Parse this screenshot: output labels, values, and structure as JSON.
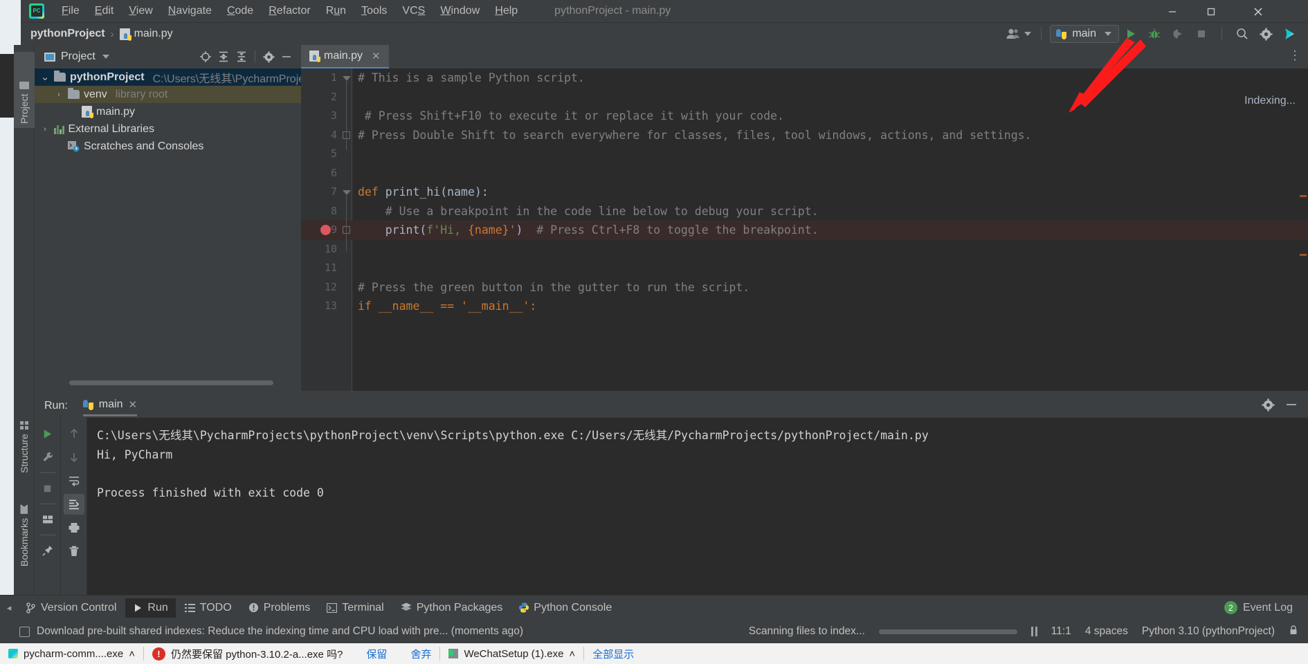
{
  "window": {
    "title": "pythonProject - main.py",
    "app_icon": "pycharm-logo-icon",
    "minimize": "─",
    "maximize": "☐",
    "close": "✕"
  },
  "menu": {
    "items": [
      {
        "label": "File",
        "mnemonic": "F"
      },
      {
        "label": "Edit",
        "mnemonic": "E"
      },
      {
        "label": "View",
        "mnemonic": "V"
      },
      {
        "label": "Navigate",
        "mnemonic": "N"
      },
      {
        "label": "Code",
        "mnemonic": "C"
      },
      {
        "label": "Refactor",
        "mnemonic": "R"
      },
      {
        "label": "Run",
        "mnemonic": "u"
      },
      {
        "label": "Tools",
        "mnemonic": "T"
      },
      {
        "label": "VCS",
        "mnemonic": "S"
      },
      {
        "label": "Window",
        "mnemonic": "W"
      },
      {
        "label": "Help",
        "mnemonic": "H"
      }
    ]
  },
  "navbar": {
    "breadcrumb_project": "pythonProject",
    "breadcrumb_sep": "›",
    "breadcrumb_file": "main.py",
    "run_config": "main",
    "icons": {
      "people": "people-icon",
      "run": "run-icon",
      "debug": "debug-icon",
      "coverage": "coverage-icon",
      "stop": "stop-icon",
      "search": "search-icon",
      "settings": "gear-icon",
      "assistant": "ai-assistant-icon"
    }
  },
  "left_strip": {
    "project": "Project",
    "structure": "Structure",
    "bookmarks": "Bookmarks"
  },
  "project_panel": {
    "title": "Project",
    "toolbar_icons": [
      "locate-icon",
      "expand-all-icon",
      "collapse-all-icon",
      "gear-icon",
      "hide-icon"
    ],
    "tree": [
      {
        "label": "pythonProject",
        "hint": "C:\\Users\\无线其\\PycharmProjec",
        "level": 0,
        "expanded": true,
        "selected": "blue",
        "icon": "folder-icon",
        "bold": true
      },
      {
        "label": "venv",
        "hint": "library root",
        "level": 1,
        "expanded": false,
        "selected": "olive",
        "icon": "folder-icon",
        "bold": false
      },
      {
        "label": "main.py",
        "hint": "",
        "level": 2,
        "expanded": null,
        "selected": "none",
        "icon": "python-file-icon",
        "bold": false
      },
      {
        "label": "External Libraries",
        "hint": "",
        "level": 0,
        "expanded": false,
        "selected": "none",
        "icon": "libraries-icon",
        "bold": false
      },
      {
        "label": "Scratches and Consoles",
        "hint": "",
        "level": 1,
        "expanded": null,
        "selected": "none",
        "icon": "scratches-icon",
        "bold": false
      }
    ]
  },
  "editor": {
    "tab": {
      "label": "main.py",
      "icon": "python-file-icon",
      "close": "✕"
    },
    "status_right": "Indexing...",
    "lines": [
      {
        "n": "1",
        "fold": "tri",
        "tokens": [
          {
            "t": "# This is a sample Python script.",
            "c": "cmt"
          }
        ]
      },
      {
        "n": "2",
        "fold": "",
        "tokens": []
      },
      {
        "n": "3",
        "fold": "",
        "tokens": [
          {
            "t": " # Press Shift+F10 to execute it or replace it with your code.",
            "c": "cmt"
          }
        ]
      },
      {
        "n": "4",
        "fold": "box",
        "tokens": [
          {
            "t": "# Press Double Shift to search everywhere for classes, files, tool windows, actions, and settings.",
            "c": "cmt"
          }
        ]
      },
      {
        "n": "5",
        "fold": "",
        "tokens": []
      },
      {
        "n": "6",
        "fold": "",
        "tokens": []
      },
      {
        "n": "7",
        "fold": "tri",
        "tokens": [
          {
            "t": "def ",
            "c": "kw"
          },
          {
            "t": "print_hi(name):",
            "c": "fn"
          }
        ]
      },
      {
        "n": "8",
        "fold": "",
        "tokens": [
          {
            "t": "    # Use a breakpoint in the code line below to debug your script.",
            "c": "cmt"
          }
        ]
      },
      {
        "n": "9",
        "fold": "box",
        "breakpoint": true,
        "highlight": true,
        "tokens": [
          {
            "t": "    print(",
            "c": "fn"
          },
          {
            "t": "f'Hi, ",
            "c": "str"
          },
          {
            "t": "{name}",
            "c": "brace"
          },
          {
            "t": "'",
            "c": "str"
          },
          {
            "t": ")",
            "c": "fn"
          },
          {
            "t": "  # Press Ctrl+F8 to toggle the breakpoint.",
            "c": "cmt"
          }
        ]
      },
      {
        "n": "10",
        "fold": "",
        "tokens": []
      },
      {
        "n": "11",
        "fold": "",
        "tokens": []
      },
      {
        "n": "12",
        "fold": "",
        "tokens": [
          {
            "t": "# Press the green button in the gutter to run the script.",
            "c": "cmt"
          }
        ]
      },
      {
        "n": "13",
        "fold": "",
        "tokens": [
          {
            "t": "if __name__ == '__main__':",
            "c": "kw"
          }
        ]
      }
    ]
  },
  "run_panel": {
    "label": "Run:",
    "tab": "main",
    "tab_icon": "python-icon",
    "tab_close": "✕",
    "header_icons": [
      "gear-icon",
      "hide-icon"
    ],
    "toolbar_left": [
      "rerun-icon",
      "wrench-icon",
      "stop-icon",
      "layout-icon",
      "pin-icon"
    ],
    "toolbar_right": [
      "up-arrow-icon",
      "down-arrow-icon",
      "soft-wrap-icon",
      "scroll-to-end-icon",
      "print-icon",
      "trash-icon"
    ],
    "console": [
      "C:\\Users\\无线其\\PycharmProjects\\pythonProject\\venv\\Scripts\\python.exe C:/Users/无线其/PycharmProjects/pythonProject/main.py",
      "Hi, PyCharm",
      "",
      "Process finished with exit code 0"
    ]
  },
  "bottom_bar": {
    "collapse": "◂",
    "items": [
      {
        "label": "Version Control",
        "icon": "branch-icon",
        "active": false
      },
      {
        "label": "Run",
        "icon": "run-icon",
        "active": true
      },
      {
        "label": "TODO",
        "icon": "todo-icon",
        "active": false
      },
      {
        "label": "Problems",
        "icon": "problems-icon",
        "active": false
      },
      {
        "label": "Terminal",
        "icon": "terminal-icon",
        "active": false
      },
      {
        "label": "Python Packages",
        "icon": "packages-icon",
        "active": false
      },
      {
        "label": "Python Console",
        "icon": "python-icon",
        "active": false
      }
    ],
    "event_log": {
      "label": "Event Log",
      "count": "2"
    }
  },
  "status_bar": {
    "message": "Download pre-built shared indexes: Reduce the indexing time and CPU load with pre... (moments ago)",
    "progress_text": "Scanning files to index...",
    "caret": "11:1",
    "indent": "4 spaces",
    "interpreter": "Python 3.10 (pythonProject)",
    "lock_icon": "lock-icon"
  },
  "taskbar": {
    "items": [
      {
        "label": "pycharm-comm....exe",
        "chevron": "˄",
        "kind": "plain"
      },
      {
        "label": "仍然要保留 python-3.10.2-a...exe 吗?",
        "kind": "alert",
        "badge": "!"
      },
      {
        "label": "保留",
        "kind": "link"
      },
      {
        "label": "舍弃",
        "kind": "link"
      },
      {
        "label": "WeChatSetup (1).exe",
        "chevron": "˄",
        "kind": "plain"
      },
      {
        "label": "全部显示",
        "kind": "link"
      }
    ]
  },
  "annotation": {
    "arrow_color": "#fb1b1b",
    "target": "run-button"
  }
}
